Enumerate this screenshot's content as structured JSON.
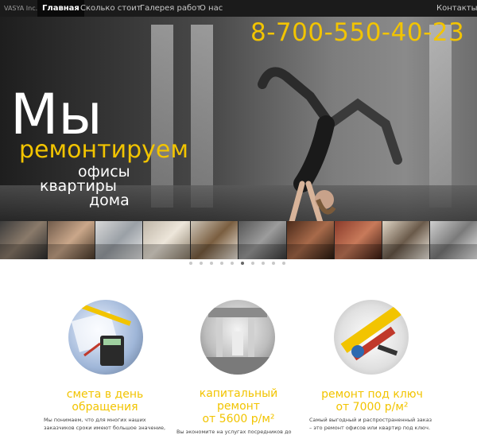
{
  "nav": {
    "brand": "VASYA Inc.",
    "items": [
      {
        "label": "Главная",
        "active": true
      },
      {
        "label": "Сколько стоит",
        "active": false
      },
      {
        "label": "Галерея работ",
        "active": false
      },
      {
        "label": "О нас",
        "active": false
      }
    ],
    "contacts": "Контакты"
  },
  "hero": {
    "phone": "8-700-550-40-23",
    "word_big": "Мы",
    "word_yellow": "ремонтируем",
    "line1": "офисы",
    "line2": "квартиры",
    "line3": "дома"
  },
  "carousel": {
    "thumb_count": 10,
    "active_index": 5,
    "dot_count": 10
  },
  "features": [
    {
      "title_line1": "смета в день",
      "title_line2": "обращения",
      "text_line1": "Мы понимаем, что для многих наших",
      "text_line2": "заказчиков сроки имеют большое значение,"
    },
    {
      "title_line1": "капитальный",
      "title_line2": "ремонт",
      "title_line3": "от 5600 р/м²",
      "text_line1": "Вы экономите на услугах посредников до"
    },
    {
      "title_line1": "ремонт под ключ",
      "title_line2": "от 7000 р/м²",
      "text_line1": "Самый выгодный и распространенный заказ",
      "text_line2": "– это ремонт офисов или квартир под ключ."
    }
  ],
  "colors": {
    "accent": "#f2c400",
    "navbar": "#1b1b1b"
  }
}
